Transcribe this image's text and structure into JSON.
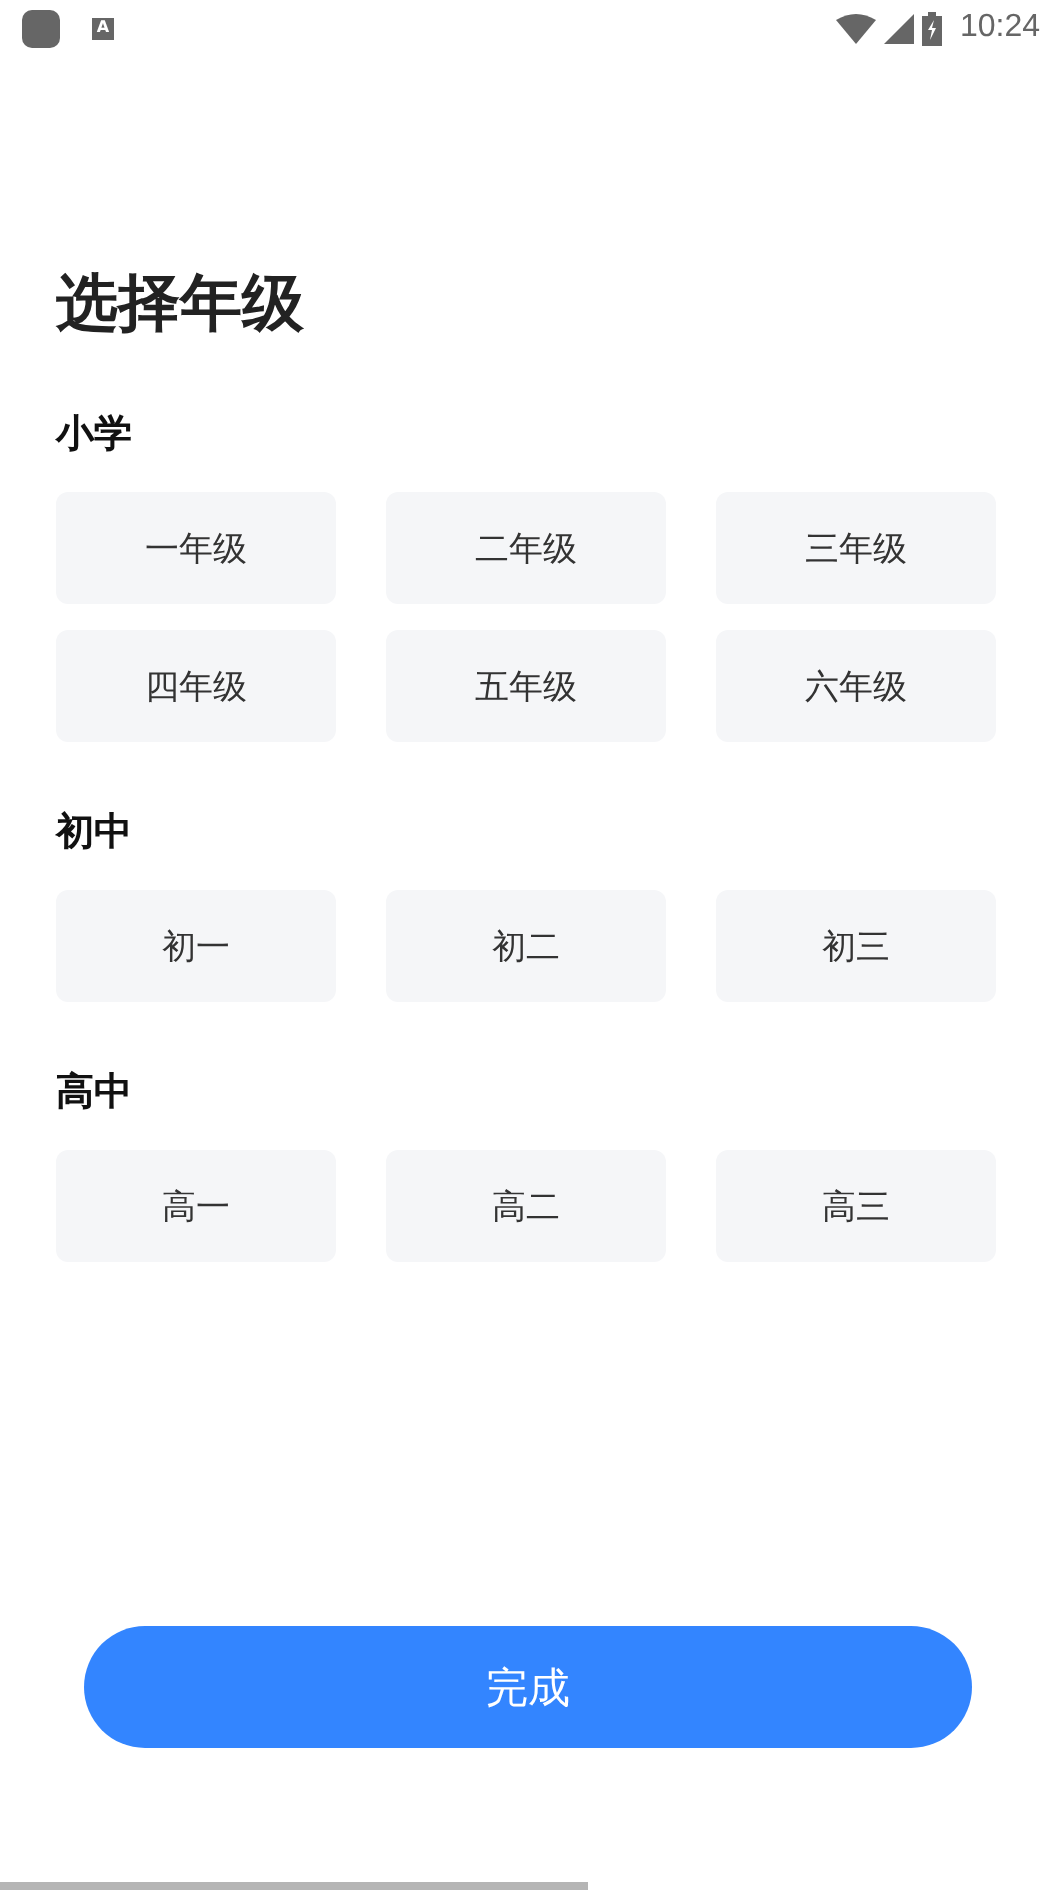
{
  "status_bar": {
    "notification_glyph": "A",
    "time": "10:24"
  },
  "title": "选择年级",
  "sections": [
    {
      "heading": "小学",
      "grades": [
        {
          "label": "一年级",
          "selected": false
        },
        {
          "label": "二年级",
          "selected": false
        },
        {
          "label": "三年级",
          "selected": false
        },
        {
          "label": "四年级",
          "selected": false
        },
        {
          "label": "五年级",
          "selected": false
        },
        {
          "label": "六年级",
          "selected": false
        }
      ]
    },
    {
      "heading": "初中",
      "grades": [
        {
          "label": "初一",
          "selected": false
        },
        {
          "label": "初二",
          "selected": false
        },
        {
          "label": "初三",
          "selected": false
        }
      ]
    },
    {
      "heading": "高中",
      "grades": [
        {
          "label": "高一",
          "selected": false
        },
        {
          "label": "高二",
          "selected": false
        },
        {
          "label": "高三",
          "selected": false
        }
      ]
    }
  ],
  "done_button": "完成"
}
